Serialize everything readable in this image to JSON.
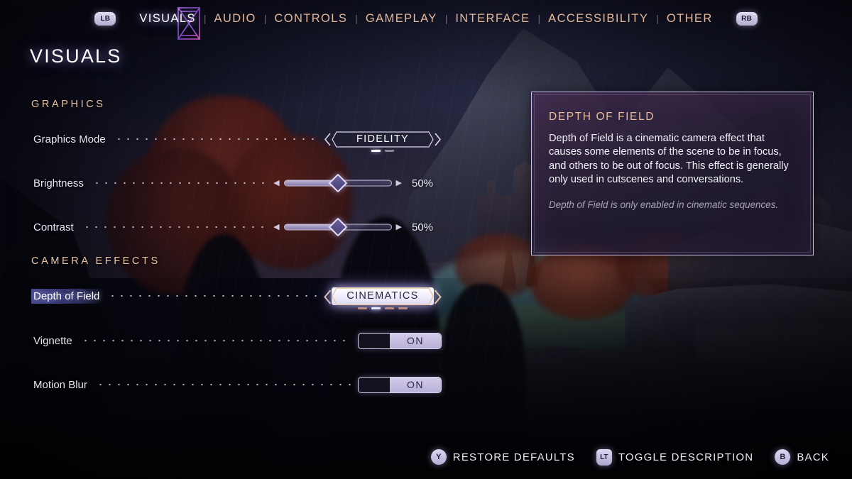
{
  "nav": {
    "left_bumper": "LB",
    "right_bumper": "RB",
    "separator": "|",
    "tabs": [
      {
        "label": "VISUALS",
        "active": true
      },
      {
        "label": "AUDIO",
        "active": false
      },
      {
        "label": "CONTROLS",
        "active": false
      },
      {
        "label": "GAMEPLAY",
        "active": false
      },
      {
        "label": "INTERFACE",
        "active": false
      },
      {
        "label": "ACCESSIBILITY",
        "active": false
      },
      {
        "label": "OTHER",
        "active": false
      }
    ]
  },
  "page": {
    "title": "VISUALS"
  },
  "sections": [
    {
      "heading": "GRAPHICS",
      "rows": [
        {
          "label": "Graphics Mode",
          "control": "stepper",
          "value": "FIDELITY",
          "option_count": 2,
          "option_index": 0,
          "selected": false
        },
        {
          "label": "Brightness",
          "control": "slider",
          "value": "50%",
          "percent": 50,
          "selected": false
        },
        {
          "label": "Contrast",
          "control": "slider",
          "value": "50%",
          "percent": 50,
          "selected": false
        }
      ]
    },
    {
      "heading": "CAMERA EFFECTS",
      "rows": [
        {
          "label": "Depth of Field",
          "control": "stepper",
          "value": "CINEMATICS",
          "option_count": 4,
          "option_index": 1,
          "selected": true
        },
        {
          "label": "Vignette",
          "control": "toggle",
          "value": "ON",
          "state": "on",
          "selected": false
        },
        {
          "label": "Motion Blur",
          "control": "toggle",
          "value": "ON",
          "state": "on",
          "selected": false
        }
      ]
    }
  ],
  "description": {
    "title": "DEPTH OF FIELD",
    "body": "Depth of Field is a cinematic camera effect that causes some elements of the scene to be in focus, and others to be out of focus. This effect is generally only used in cutscenes and conversations.",
    "note": "Depth of Field is only enabled in cinematic sequences."
  },
  "footer": {
    "prompts": [
      {
        "button": "Y",
        "label": "RESTORE DEFAULTS",
        "shape": "round"
      },
      {
        "button": "LT",
        "label": "TOGGLE DESCRIPTION",
        "shape": "trigger"
      },
      {
        "button": "B",
        "label": "BACK",
        "shape": "round"
      }
    ]
  },
  "icons": {
    "hourglass": "hourglass-icon",
    "left_arrow": "chevron-left-icon",
    "right_arrow": "chevron-right-icon"
  },
  "colors": {
    "accent_warm": "#e3b89b",
    "accent_title": "#e9bb9b",
    "selected_text": "#ffffff",
    "selection_highlight": "#5c60be",
    "panel_border": "#c9c0e6",
    "button_chip": "#ded7f2"
  }
}
